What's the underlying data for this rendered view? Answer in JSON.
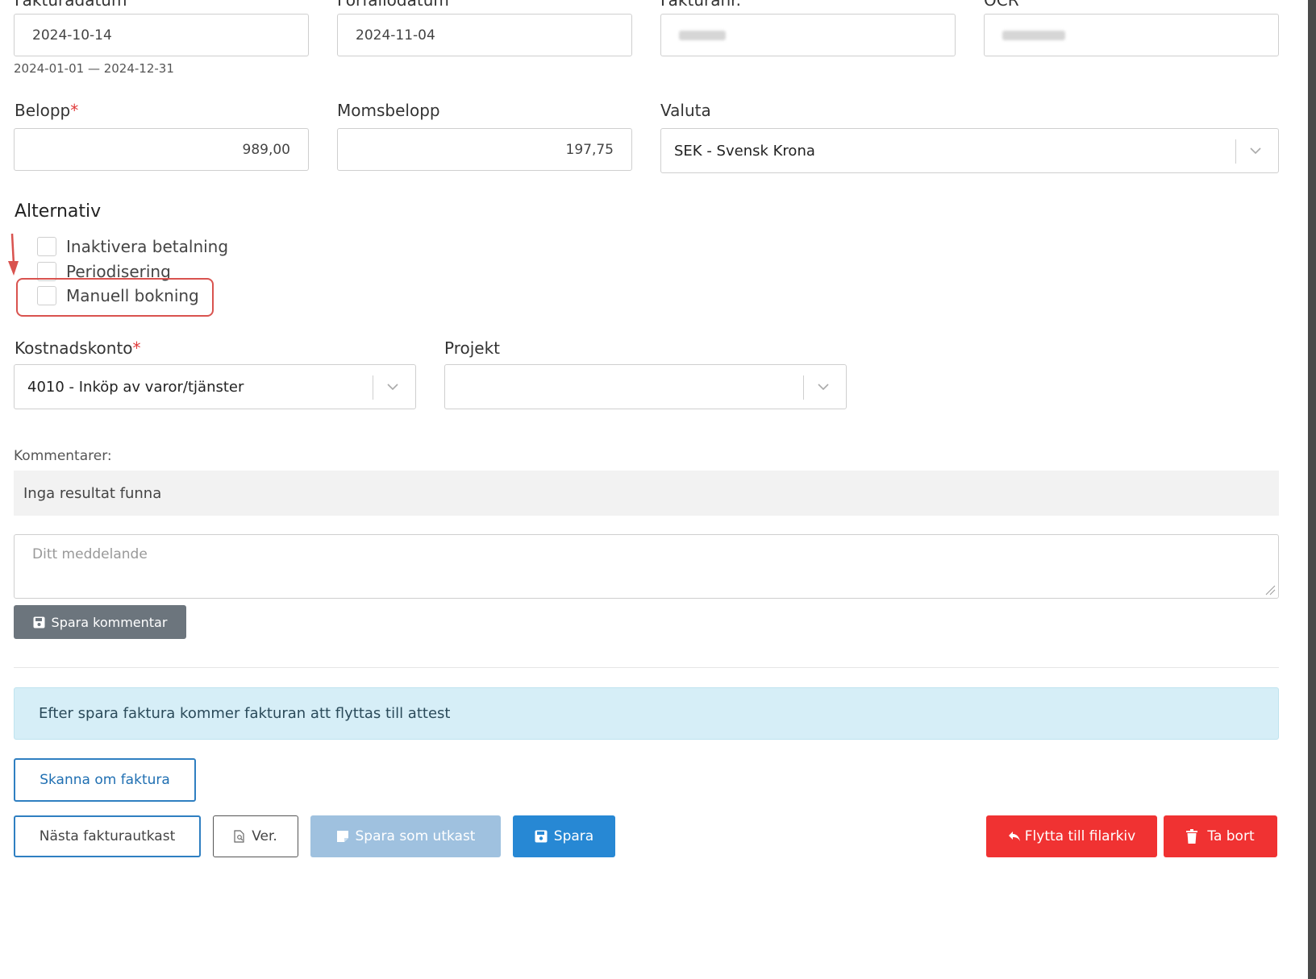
{
  "fields_top": {
    "fakturadatum": {
      "label": "Fakturadatum",
      "value": "2024-10-14",
      "range_hint": "2024-01-01 — 2024-12-31"
    },
    "forfallodatum": {
      "label": "Förfallodatum",
      "value": "2024-11-04"
    },
    "fakturanr": {
      "label": "Fakturanr."
    },
    "ocr": {
      "label": "OCR"
    }
  },
  "amounts": {
    "belopp": {
      "label": "Belopp",
      "value": "989,00"
    },
    "momsbelopp": {
      "label": "Momsbelopp",
      "value": "197,75"
    },
    "valuta": {
      "label": "Valuta",
      "value": "SEK - Svensk Krona"
    }
  },
  "alternativ": {
    "title": "Alternativ",
    "options": [
      {
        "label": "Inaktivera betalning",
        "checked": false
      },
      {
        "label": "Periodisering",
        "checked": false
      },
      {
        "label": "Manuell bokning",
        "checked": false
      }
    ]
  },
  "accounts": {
    "kostnadskonto": {
      "label": "Kostnadskonto",
      "value": "4010 - Inköp av varor/tjänster"
    },
    "projekt": {
      "label": "Projekt",
      "value": ""
    }
  },
  "comments": {
    "label": "Kommentarer:",
    "empty_text": "Inga resultat funna",
    "placeholder": "Ditt meddelande",
    "save_label": "Spara kommentar"
  },
  "info_message": "Efter spara faktura kommer fakturan att flyttas till attest",
  "actions": {
    "rescan": "Skanna om faktura",
    "next_draft": "Nästa fakturautkast",
    "ver": "Ver.",
    "save_draft": "Spara som utkast",
    "save": "Spara",
    "move_archive": "Flytta till filarkiv",
    "delete": "Ta bort"
  },
  "colors": {
    "primary": "#2788d4",
    "danger": "#f03232",
    "disabled": "#9fc1df",
    "info_bg": "#d6eef7",
    "annotation": "#d9534f"
  }
}
